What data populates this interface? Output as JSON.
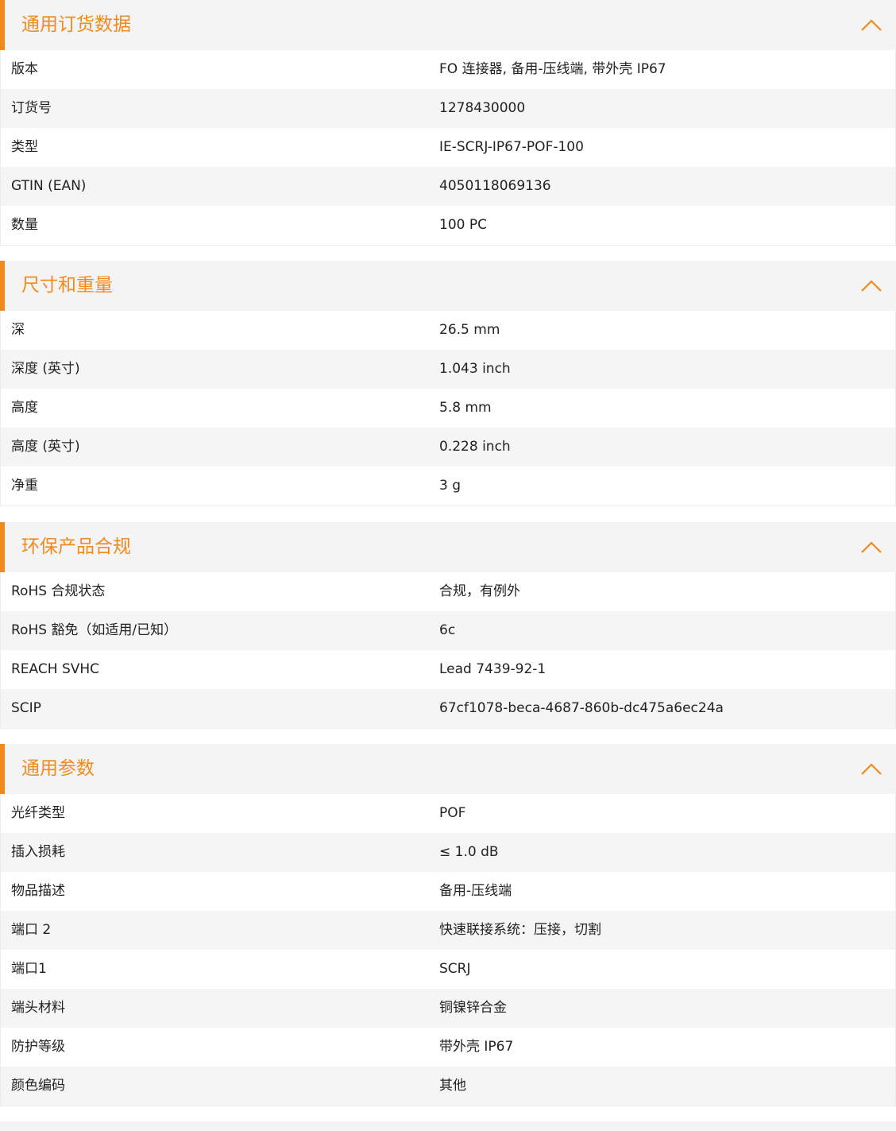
{
  "sections": [
    {
      "title": "通用订货数据",
      "rows": [
        {
          "label": "版本",
          "value": "FO 连接器, 备用-压线端, 带外壳 IP67"
        },
        {
          "label": "订货号",
          "value": "1278430000"
        },
        {
          "label": "类型",
          "value": "IE-SCRJ-IP67-POF-100"
        },
        {
          "label": "GTIN (EAN)",
          "value": "4050118069136"
        },
        {
          "label": "数量",
          "value": "100  PC"
        }
      ]
    },
    {
      "title": "尺寸和重量",
      "rows": [
        {
          "label": "深",
          "value": "26.5  mm"
        },
        {
          "label": "深度 (英寸)",
          "value": "1.043  inch"
        },
        {
          "label": "高度",
          "value": "5.8  mm"
        },
        {
          "label": "高度 (英寸)",
          "value": "0.228  inch"
        },
        {
          "label": "净重",
          "value": "3  g"
        }
      ]
    },
    {
      "title": "环保产品合规",
      "rows": [
        {
          "label": "RoHS 合规状态",
          "value": "合规，有例外"
        },
        {
          "label": "RoHS 豁免（如适用/已知）",
          "value": "6c"
        },
        {
          "label": "REACH SVHC",
          "value": "Lead 7439-92-1"
        },
        {
          "label": "SCIP",
          "value": "67cf1078-beca-4687-860b-dc475a6ec24a"
        }
      ]
    },
    {
      "title": "通用参数",
      "rows": [
        {
          "label": "光纤类型",
          "value": "POF"
        },
        {
          "label": "插入损耗",
          "value": "≤ 1.0 dB"
        },
        {
          "label": "物品描述",
          "value": "备用-压线端"
        },
        {
          "label": "端口 2",
          "value": "快速联接系统：压接，切割"
        },
        {
          "label": "端口1",
          "value": "SCRJ"
        },
        {
          "label": "端头材料",
          "value": "铜镍锌合金"
        },
        {
          "label": "防护等级",
          "value": "带外壳 IP67"
        },
        {
          "label": "颜色编码",
          "value": "其他"
        }
      ]
    }
  ],
  "colors": {
    "accent": "#f08a1c",
    "header_bg": "#f4f4f4",
    "row_alt_bg": "#f5f5f5"
  },
  "icons": {
    "collapse": "chevron-up-icon"
  }
}
